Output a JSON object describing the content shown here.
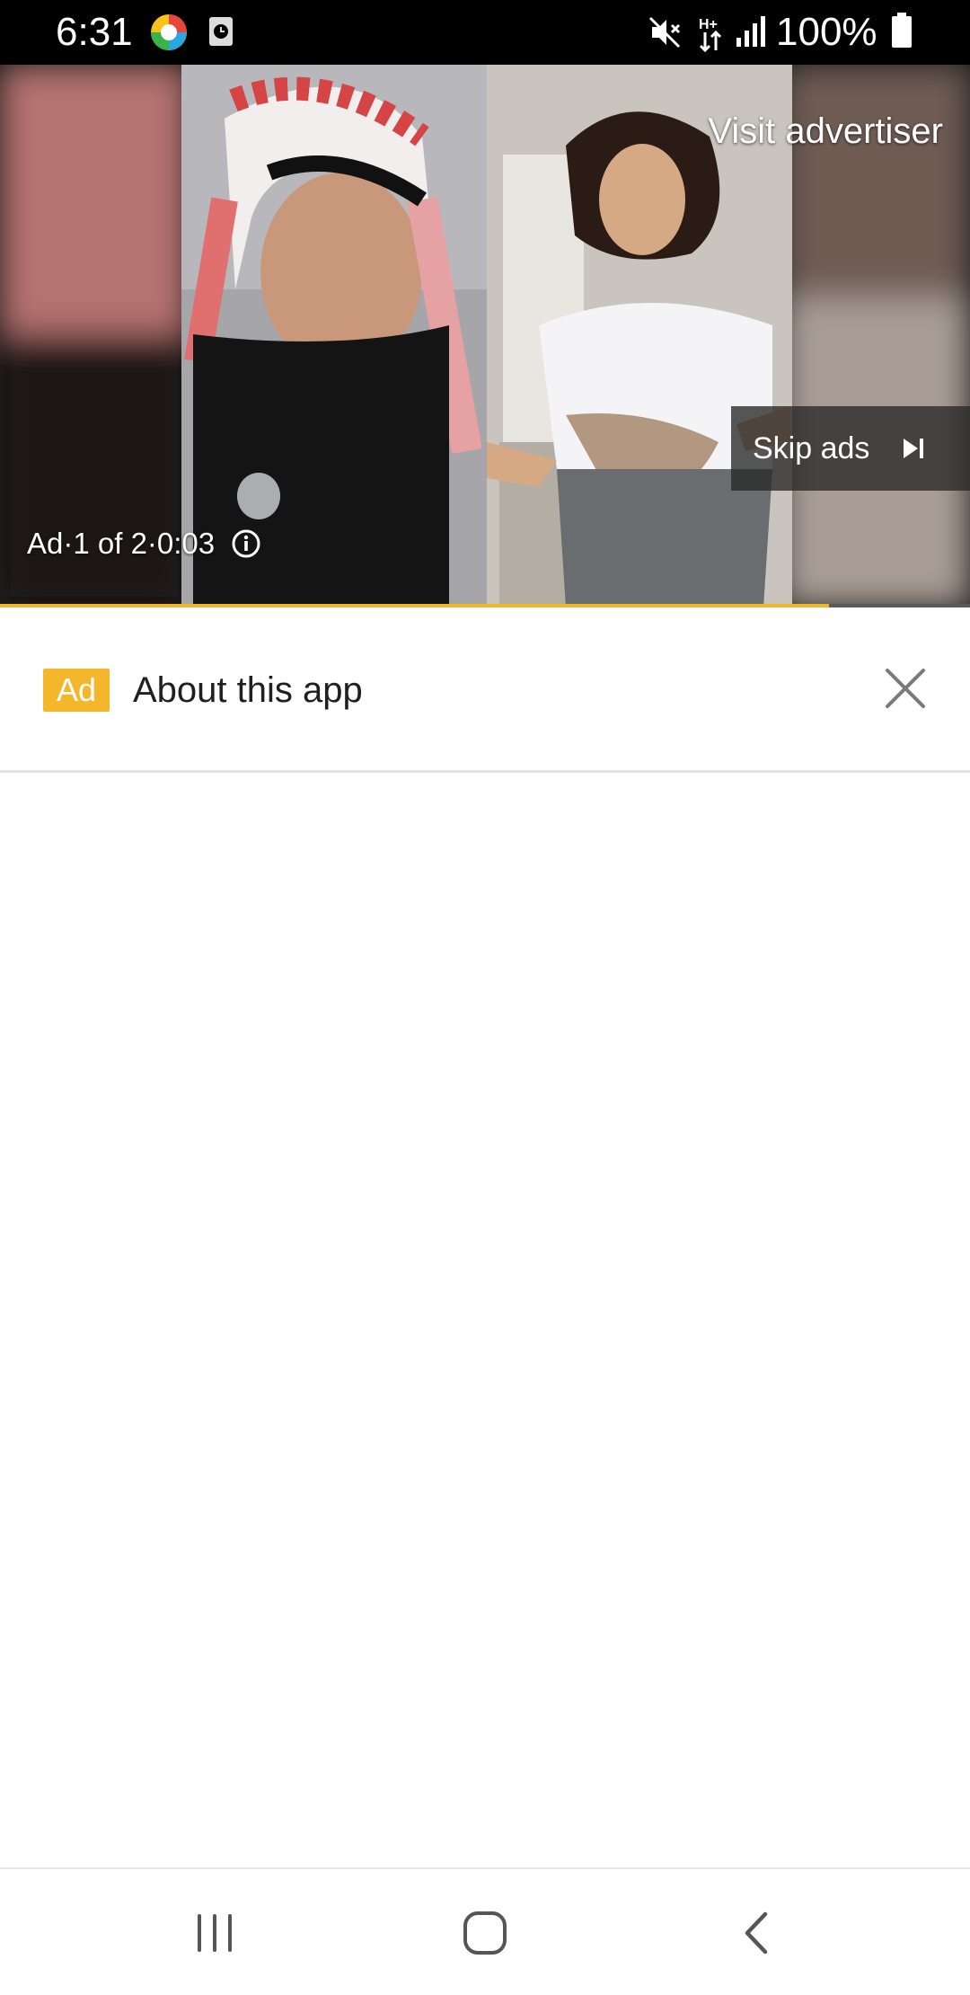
{
  "status_bar": {
    "time": "6:31",
    "battery_percent": "100%",
    "icons": [
      "app-notification-icon",
      "clock-app-icon",
      "mute-icon",
      "data-transfer-icon",
      "signal-icon",
      "battery-icon"
    ]
  },
  "video_ad": {
    "visit_advertiser": "Visit advertiser",
    "skip_ads": "Skip ads",
    "ad_counter": "Ad·1 of 2·0:03",
    "progress": 0.855,
    "accent_color": "#f0b72a"
  },
  "header": {
    "ad_badge": "Ad",
    "title": "About this app",
    "badge_color": "#f4b72b"
  },
  "nav_bar": {
    "icons": [
      "recents-icon",
      "home-icon",
      "back-icon"
    ]
  }
}
